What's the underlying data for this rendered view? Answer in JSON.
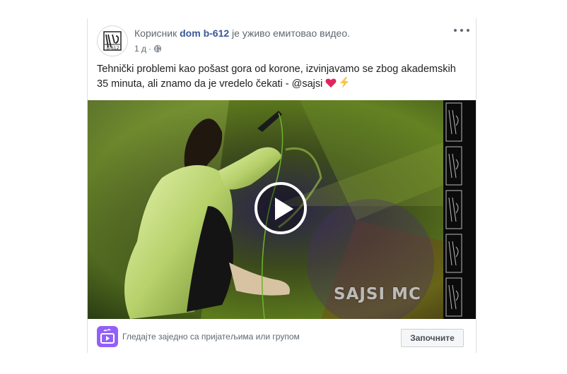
{
  "post": {
    "header_prefix": "Корисник",
    "page_name": "dom b-612",
    "header_suffix": "је уживо емитовао видео.",
    "time": "1 д",
    "meta_separator": "·",
    "text": "Tehnički problemi kao pošast gora od korone, izvinjavamo se zbog akademskih 35 minuta, ali znamo da je vredelo čekati - @sajsi",
    "emoji": [
      "red-heart",
      "lightning"
    ]
  },
  "video": {
    "watermark": "SAJSI MC",
    "play_icon": "play-icon"
  },
  "footer": {
    "watch_together_text": "Гледајте заједно са пријатељима или групом",
    "start_label": "Започните"
  },
  "colors": {
    "link": "#385898",
    "watch_party_icon": "#9360f7",
    "heart": "#e0245e",
    "lightning": "#f7c64b"
  },
  "icons": {
    "avatar_logo": "dom-b612-logo",
    "privacy": "globe-icon",
    "more": "more-options-icon",
    "watch_party": "watch-party-icon"
  }
}
